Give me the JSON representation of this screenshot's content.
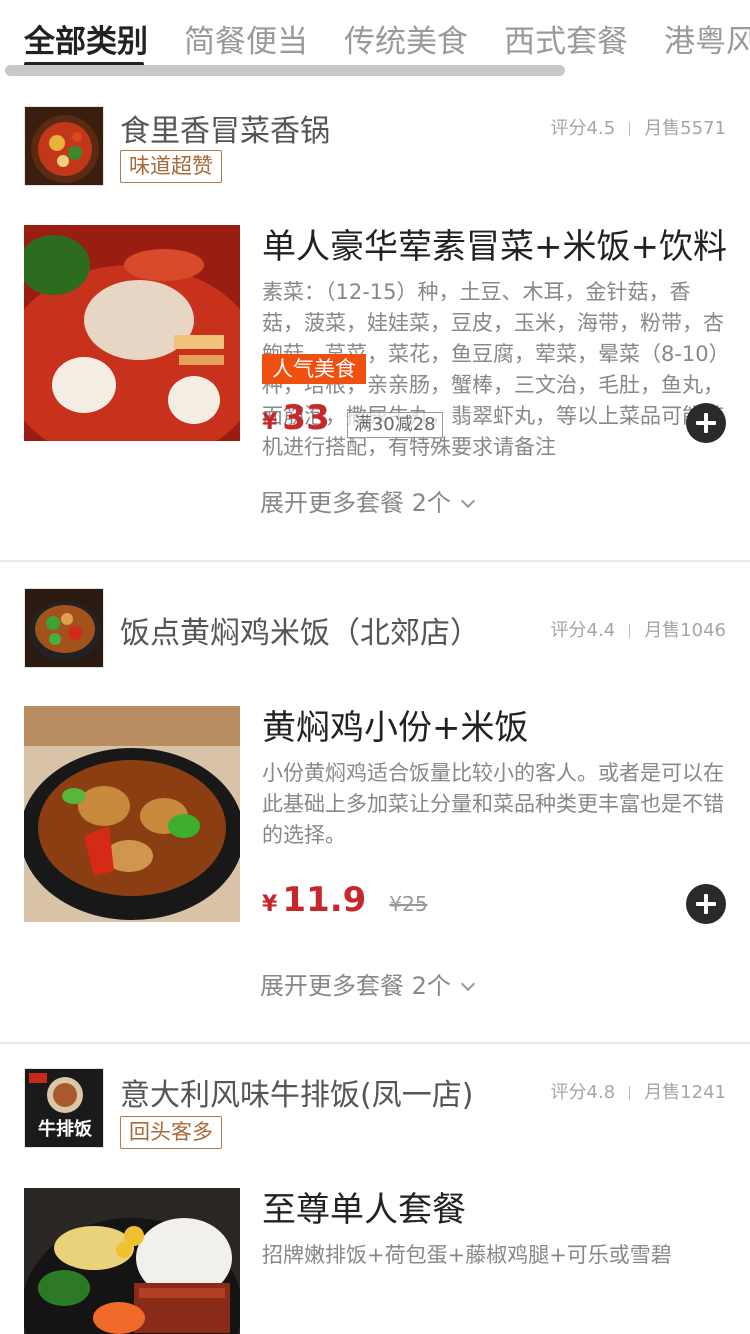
{
  "tabs": [
    "全部类别",
    "简餐便当",
    "传统美食",
    "西式套餐",
    "港粤风"
  ],
  "shops": [
    {
      "name": "食里香冒菜香锅",
      "rating": "评分4.5",
      "monthly_sales": "月售5571",
      "tag": "味道超赞",
      "dish": {
        "title": "单人豪华荤素冒菜+米饭+饮料",
        "desc": "素菜：（12-15）种，土豆、木耳，金针菇，香菇，菠菜，娃娃菜，豆皮，玉米，海带，粉带，杏鲍菇，莴菜，菜花，鱼豆腐，荤菜，晕菜（8-10）种，培根，亲亲肠，蟹棒，三文治，毛肚，鱼丸，面筋泡，撒尿牛丸，翡翠虾丸，等以上菜品可能随机进行搭配，有特殊要求请备注",
        "badge": "人气美食",
        "currency": "¥",
        "price": "33",
        "promo": "满30减28",
        "expand": "展开更多套餐 2个"
      }
    },
    {
      "name": "饭点黄焖鸡米饭（北郊店）",
      "rating": "评分4.4",
      "monthly_sales": "月售1046",
      "dish": {
        "title": "黄焖鸡小份+米饭",
        "desc": "小份黄焖鸡适合饭量比较小的客人。或者是可以在此基础上多加菜让分量和菜品种类更丰富也是不错的选择。",
        "currency": "¥",
        "price": "11.9",
        "old_price": "¥25",
        "expand": "展开更多套餐 2个"
      }
    },
    {
      "name": "意大利风味牛排饭(凤一店)",
      "rating": "评分4.8",
      "monthly_sales": "月售1241",
      "tag": "回头客多",
      "logo_text": "牛排饭",
      "dish": {
        "title": "至尊单人套餐",
        "desc": "招牌嫩排饭+荷包蛋+藤椒鸡腿+可乐或雪碧"
      }
    }
  ],
  "colors": {
    "price_red": "#c7262b",
    "badge_orange": "#f0500f",
    "tag_brown": "#a86a3a",
    "add_button": "#2a2a2a"
  }
}
